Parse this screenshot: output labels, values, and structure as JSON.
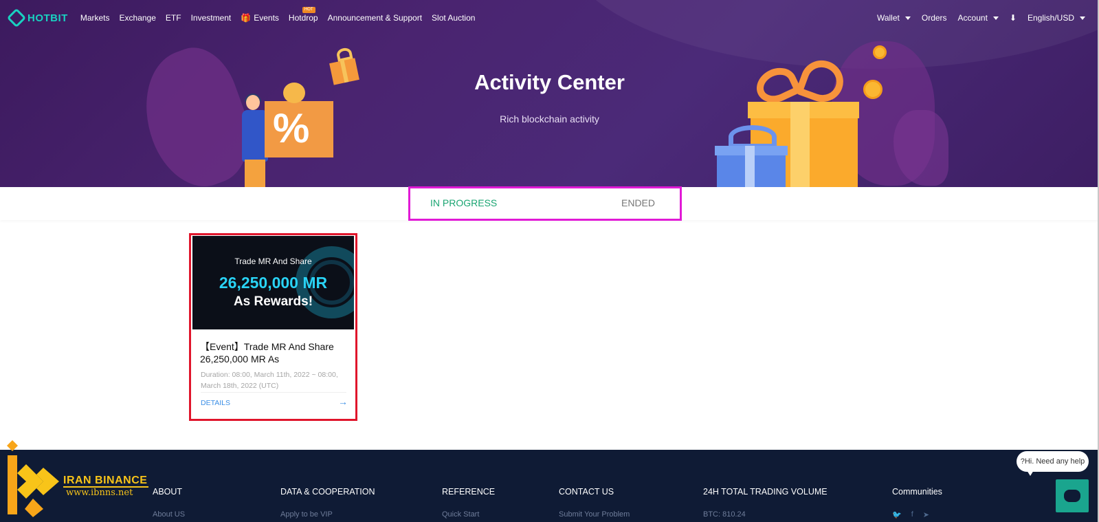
{
  "brand": {
    "name": "HOTBIT"
  },
  "nav": {
    "items": [
      "Markets",
      "Exchange",
      "ETF",
      "Investment",
      "Events",
      "Hotdrop",
      "Announcement & Support",
      "Slot Auction"
    ],
    "hot_badge": "HOT",
    "right": {
      "wallet": "Wallet",
      "orders": "Orders",
      "account": "Account",
      "language": "English/USD"
    }
  },
  "hero": {
    "title": "Activity Center",
    "subtitle": "Rich blockchain activity",
    "illustration_text": "%"
  },
  "tabs": {
    "in_progress": "IN PROGRESS",
    "ended": "ENDED",
    "active": "in_progress"
  },
  "events": [
    {
      "banner_line1": "Trade MR And Share",
      "banner_line2": "26,250,000 MR",
      "banner_line3": "As Rewards!",
      "title": "【Event】Trade MR And Share 26,250,000 MR As",
      "duration": "Duration: 08:00, March 11th, 2022 ~ 08:00, March 18th, 2022 (UTC)",
      "details_label": "DETAILS",
      "arrow": "→"
    }
  ],
  "footer": {
    "columns": [
      {
        "heading": "ABOUT",
        "first_item": "About US"
      },
      {
        "heading": "DATA & COOPERATION",
        "first_item": "Apply to be VIP"
      },
      {
        "heading": "REFERENCE",
        "first_item": "Quick Start"
      },
      {
        "heading": "CONTACT US",
        "first_item": "Submit Your Problem"
      },
      {
        "heading": "24H TOTAL TRADING VOLUME",
        "first_item": "BTC: 810.24"
      },
      {
        "heading": "Communities",
        "first_item": ""
      }
    ]
  },
  "watermark": {
    "line1": "IRAN BINANCE",
    "line2": "www.ibnns.net"
  },
  "chat": {
    "bubble": "?Hi. Need any help"
  },
  "colors": {
    "accent": "#1aa572",
    "hero_bg": "#4a2470",
    "footer_bg": "#0f1b35",
    "link": "#3a8ee6",
    "highlight_tabs": "#e11ad6",
    "highlight_card": "#e0152b"
  }
}
